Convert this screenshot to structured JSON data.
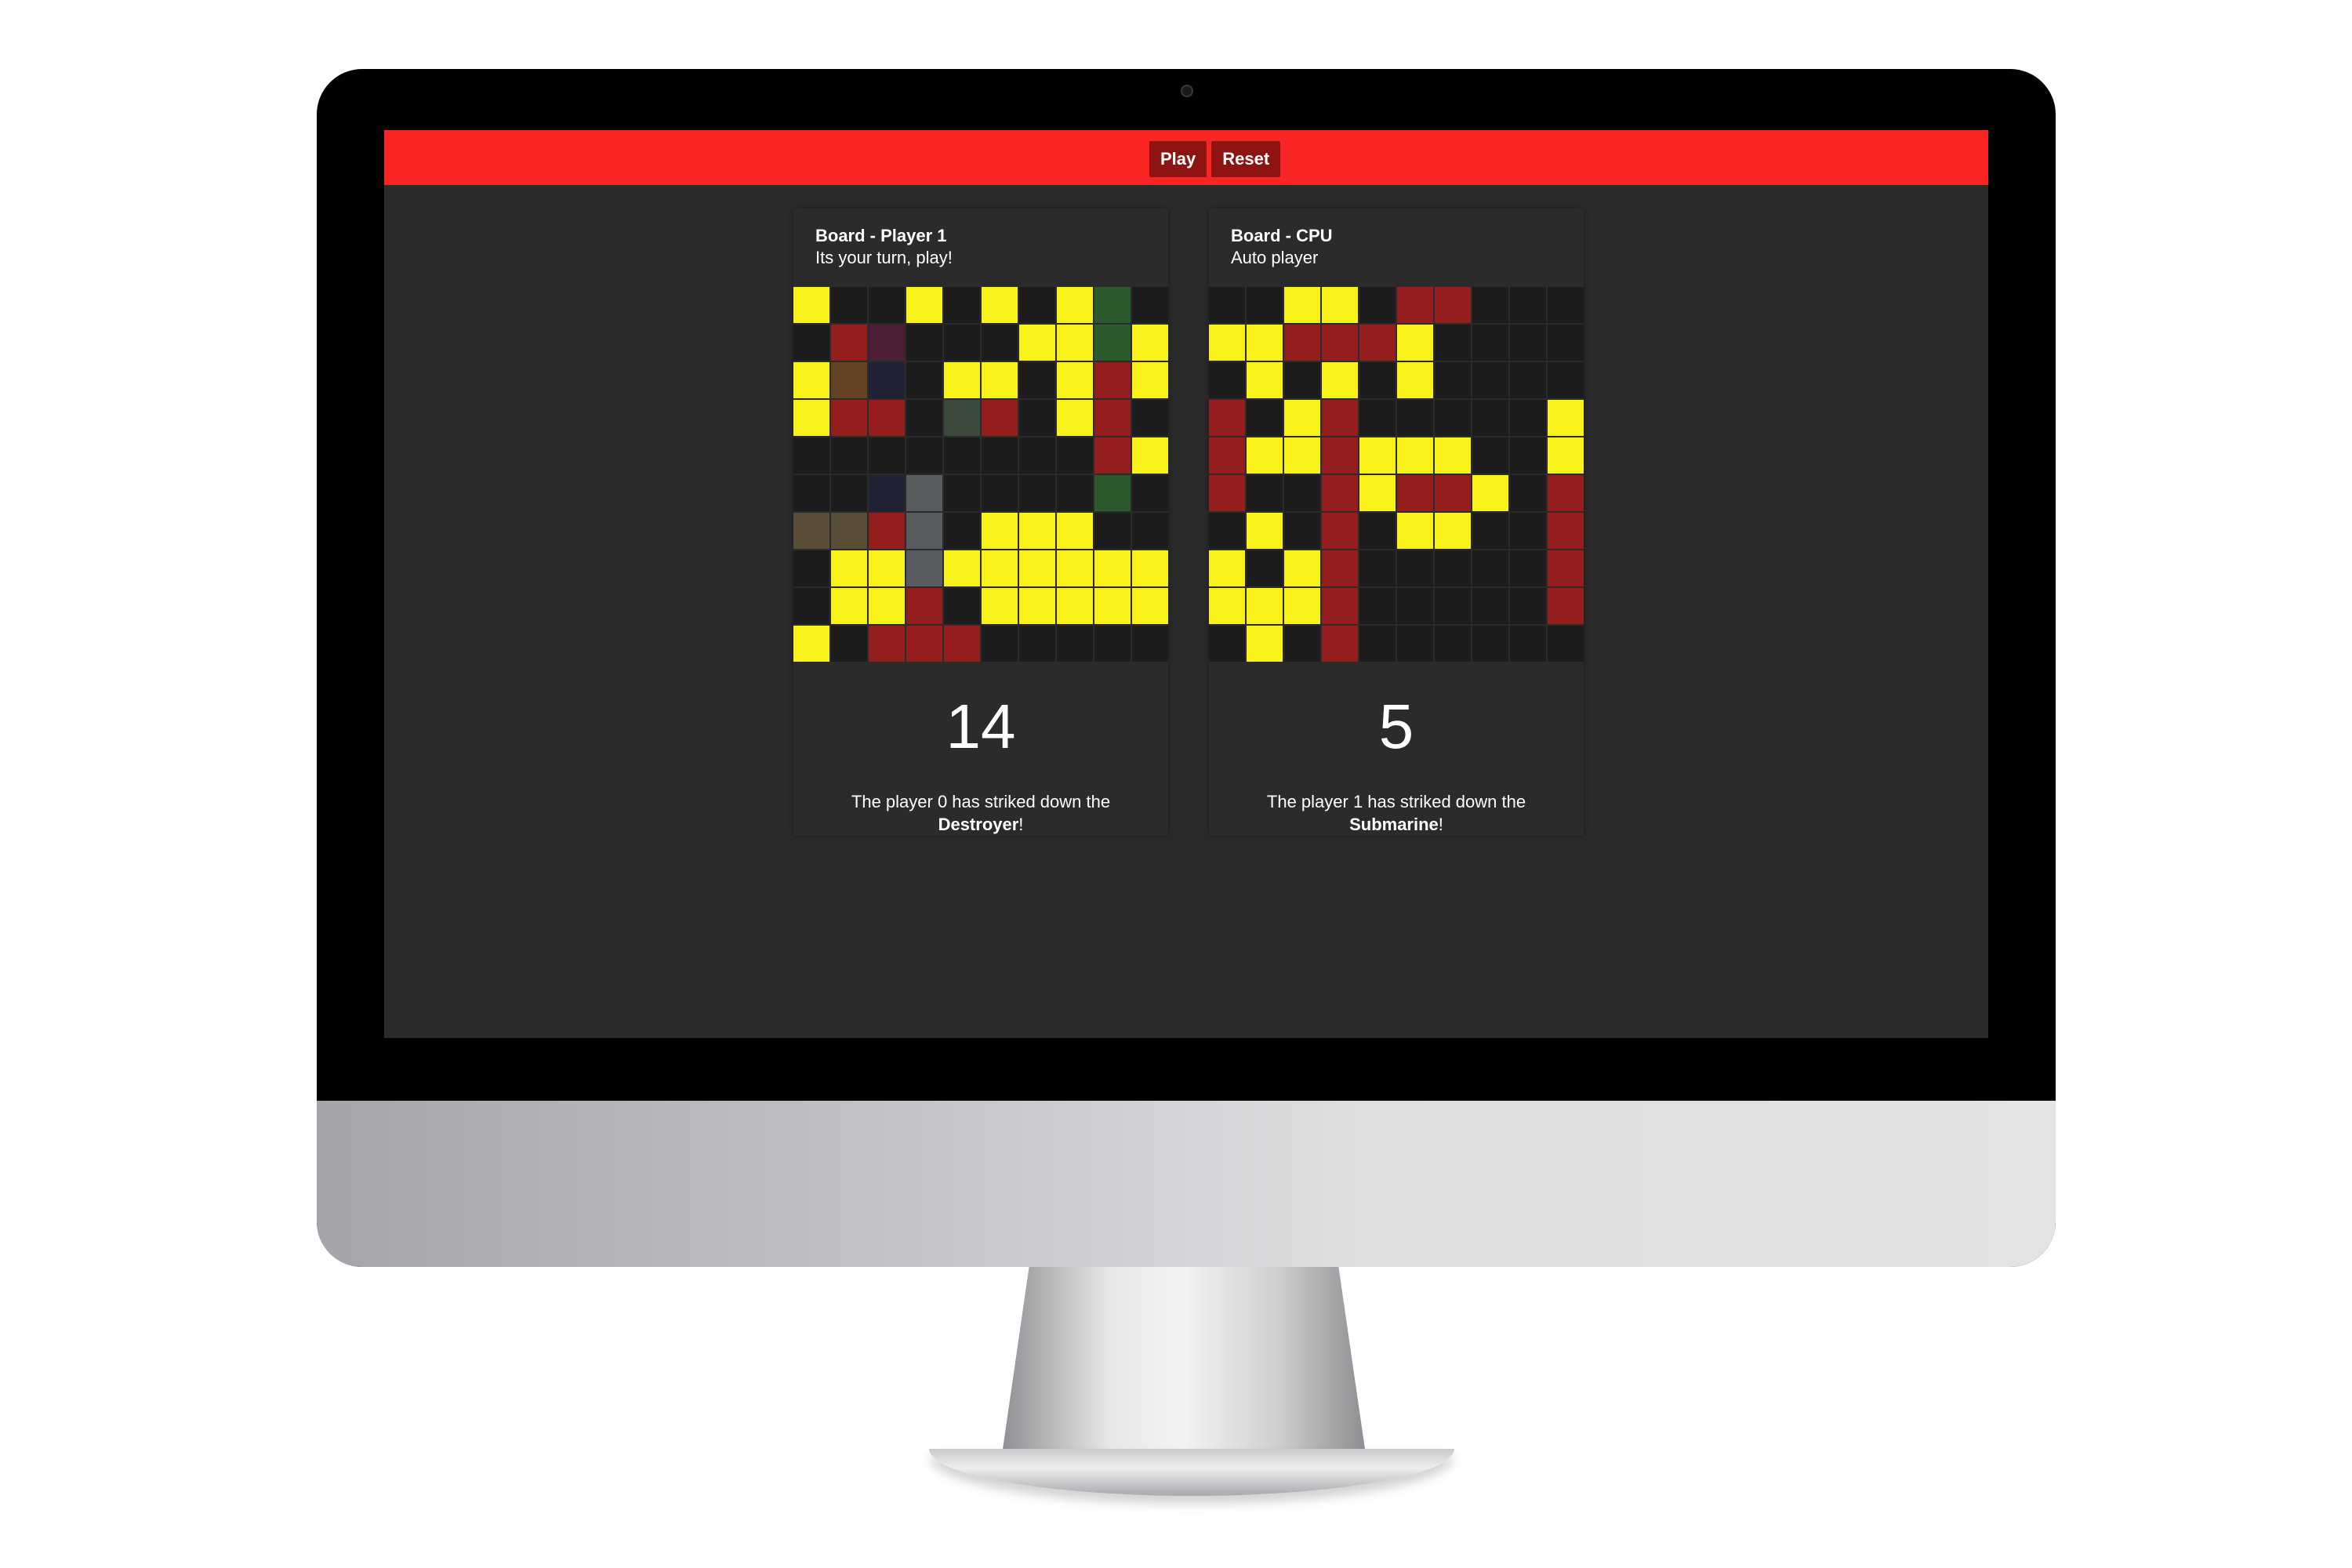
{
  "toolbar": {
    "play_label": "Play",
    "reset_label": "Reset"
  },
  "boards": [
    {
      "title": "Board - Player 1",
      "subtitle": "Its your turn, play!",
      "score": "14",
      "message_prefix": "The player 0 has striked down the",
      "ship": "Destroyer",
      "message_suffix": "!",
      "grid": [
        "h..h.h.hg.",
        ".rp...hhgh",
        "hbn.hh.hrh",
        "hrr.kr.hr.",
        "........rh",
        "..ns....g.",
        "oors.hhh..",
        ".hhshhhhhh",
        ".hhr.hhhhh",
        "h.rrr....."
      ]
    },
    {
      "title": "Board - CPU",
      "subtitle": "Auto player",
      "score": "5",
      "message_prefix": "The player 1 has striked down the",
      "ship": "Submarine",
      "message_suffix": "!",
      "grid": [
        "..hh.rr...",
        "hhrrrh....",
        ".h.h.h....",
        "r.hr.....h",
        "rhhrhhh..h",
        "r..rhrrh.r",
        ".h.r.hh..r",
        "h.hr.....r",
        "hhhr.....r",
        ".h.r......"
      ]
    }
  ],
  "cell_legend": {
    ".": "empty",
    "h": "miss-yellow",
    "r": "hit-red",
    "g": "ship-green",
    "p": "ship-purple",
    "n": "ship-navy",
    "b": "ship-brown",
    "k": "ship-darkgreen",
    "s": "ship-slate",
    "o": "ship-olive"
  },
  "colors": {
    "topbar": "#f92525",
    "button": "#8e1414",
    "screen_bg": "#2a2a2a",
    "miss": "#f9f21a",
    "hit": "#941d1d",
    "empty": "#1d1d1d"
  }
}
